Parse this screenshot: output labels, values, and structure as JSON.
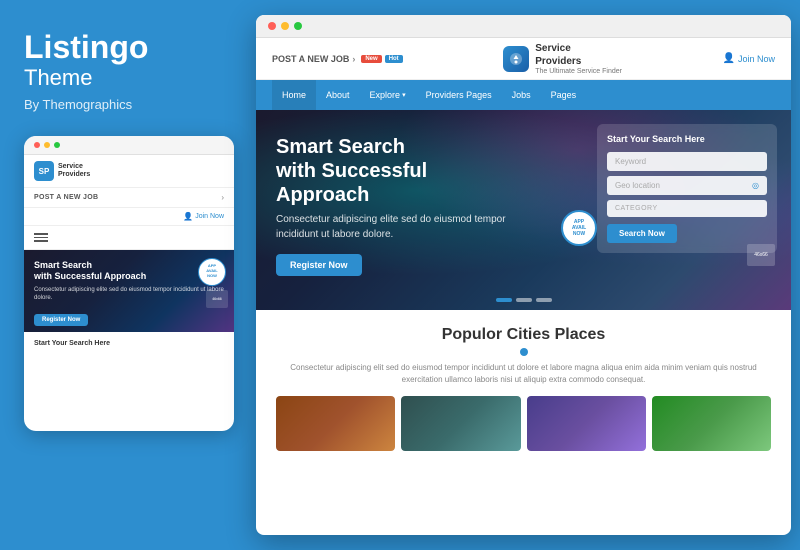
{
  "left": {
    "brand_name": "Listingo",
    "brand_theme": "Theme",
    "brand_by": "By Themographics",
    "dots": [
      "red",
      "yellow",
      "green"
    ],
    "mobile": {
      "post_job": "POST A NEW JOB",
      "join_now": "Join Now",
      "hero_title": "Smart Search",
      "hero_subtitle": "with Successful Approach",
      "hero_body": "Consectetur adipiscing elite sed do eiusmod tempor incididunt ut labore dolore.",
      "register_btn": "Register Now",
      "search_section_title": "Start Your Search Here",
      "app_badge": "APP AVAILABLE NOW",
      "preview_label": "46x66"
    }
  },
  "right": {
    "browser_dots": [
      "red",
      "yellow",
      "green"
    ],
    "site": {
      "post_job": "POST A NEW JOB",
      "logo_name": "Service Providers",
      "logo_tagline": "The Ultimate Service Finder",
      "join_now": "Join Now",
      "tag_new": "New",
      "tag_hot": "Hot"
    },
    "nav_items": [
      "Home",
      "About",
      "Explore",
      "Providers Pages",
      "Jobs",
      "Pages"
    ],
    "hero": {
      "title_line1": "Smart Search",
      "title_line2": "with Successful Approach",
      "body": "Consectetur adipiscing elite sed do eiusmod tempor incididunt ut labore dolore.",
      "register_btn": "Register Now"
    },
    "search_widget": {
      "title": "Start Your Search Here",
      "keyword_placeholder": "Keyword",
      "geo_placeholder": "Geo location",
      "category_placeholder": "CATEGORY",
      "search_btn": "Search Now",
      "app_badge": "APP AVAILABLE NOW",
      "preview_label": "46x66"
    },
    "content": {
      "section_title": "Populor Cities Places",
      "section_desc": "Consectetur adipiscing elit sed do eiusmod tempor incididunt ut dolore et labore magna aliqua enim aida minim veniam quis nostrud exercitation ullamco laboris nisi ut aliquip extra commodo consequat.",
      "city_images": [
        "city1",
        "city2",
        "city3",
        "city4"
      ]
    }
  }
}
